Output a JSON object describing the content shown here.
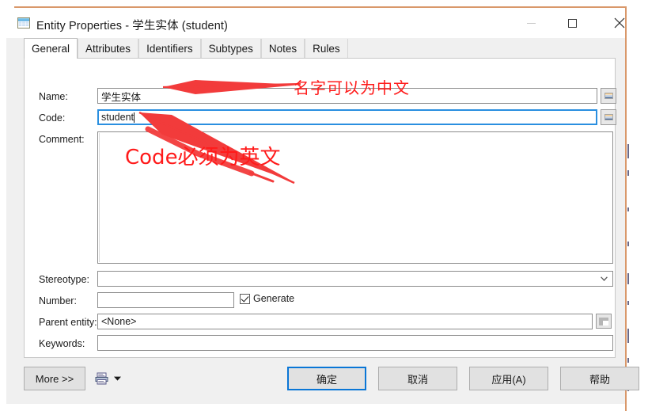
{
  "window": {
    "icon": "table-grid-icon",
    "title": "Entity Properties - 学生实体 (student)",
    "controls": {
      "minimize": "minimize-icon",
      "maximize": "maximize-icon",
      "close": "✕"
    }
  },
  "tabs": [
    {
      "label": "General",
      "active": true
    },
    {
      "label": "Attributes",
      "active": false
    },
    {
      "label": "Identifiers",
      "active": false
    },
    {
      "label": "Subtypes",
      "active": false
    },
    {
      "label": "Notes",
      "active": false
    },
    {
      "label": "Rules",
      "active": false
    }
  ],
  "form": {
    "name": {
      "label": "Name:",
      "value": "学生实体",
      "placeholder": "",
      "focused": false,
      "side_button": "="
    },
    "code": {
      "label": "Code:",
      "value": "student",
      "placeholder": "",
      "focused": true,
      "side_button": "="
    },
    "comment": {
      "label": "Comment:",
      "value": "",
      "placeholder": ""
    },
    "stereotype": {
      "label": "Stereotype:",
      "value": "",
      "placeholder": ""
    },
    "number": {
      "label": "Number:",
      "value": "",
      "placeholder": "",
      "generate_label": "Generate",
      "generate_checked": true
    },
    "parent_entity": {
      "label": "Parent entity:",
      "value": "<None>",
      "browse": "browse-folder-icon"
    },
    "keywords": {
      "label": "Keywords:",
      "value": "",
      "placeholder": ""
    }
  },
  "footer": {
    "more": "More >>",
    "report_icon": "printer-icon",
    "report_dropdown": "chevron-down-icon",
    "ok": "确定",
    "cancel": "取消",
    "apply": "应用(A)",
    "help": "帮助"
  },
  "annotations": {
    "color": "#ff1a1a",
    "name_note": "名字可以为中文",
    "code_note": "Code必须为英文",
    "arrow_to_name": "arrow-pointing-to-name-field",
    "arrow_to_code": "arrow-pointing-to-code-field"
  }
}
